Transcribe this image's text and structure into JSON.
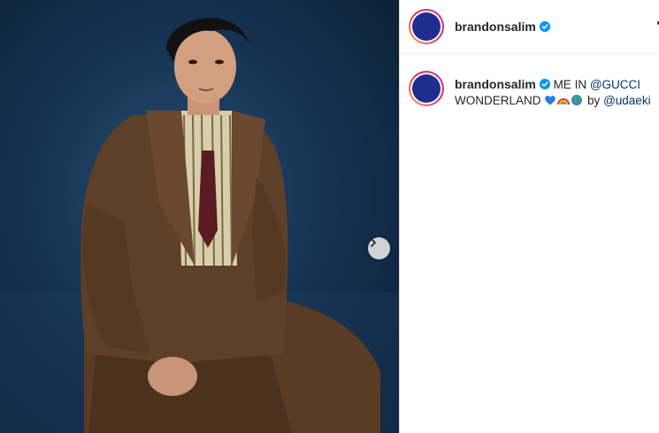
{
  "post": {
    "username": "brandonsalim",
    "caption": {
      "prefix": "ME IN",
      "mention1": "@GUCCI",
      "line2": "WONDERLAND",
      "by": "by",
      "mention2": "@udaeki"
    },
    "emojis": [
      "blue-heart",
      "rainbow",
      "earth-globe"
    ]
  },
  "colors": {
    "accent": "#0095f6",
    "avatar": "#1f2d8f",
    "mention": "#00376b",
    "photo_bg": "#163453",
    "suit": "#5a3c25"
  },
  "icons": {
    "next": "chevron-right-icon",
    "verified": "verified-badge-icon",
    "more": "more-options-icon"
  }
}
